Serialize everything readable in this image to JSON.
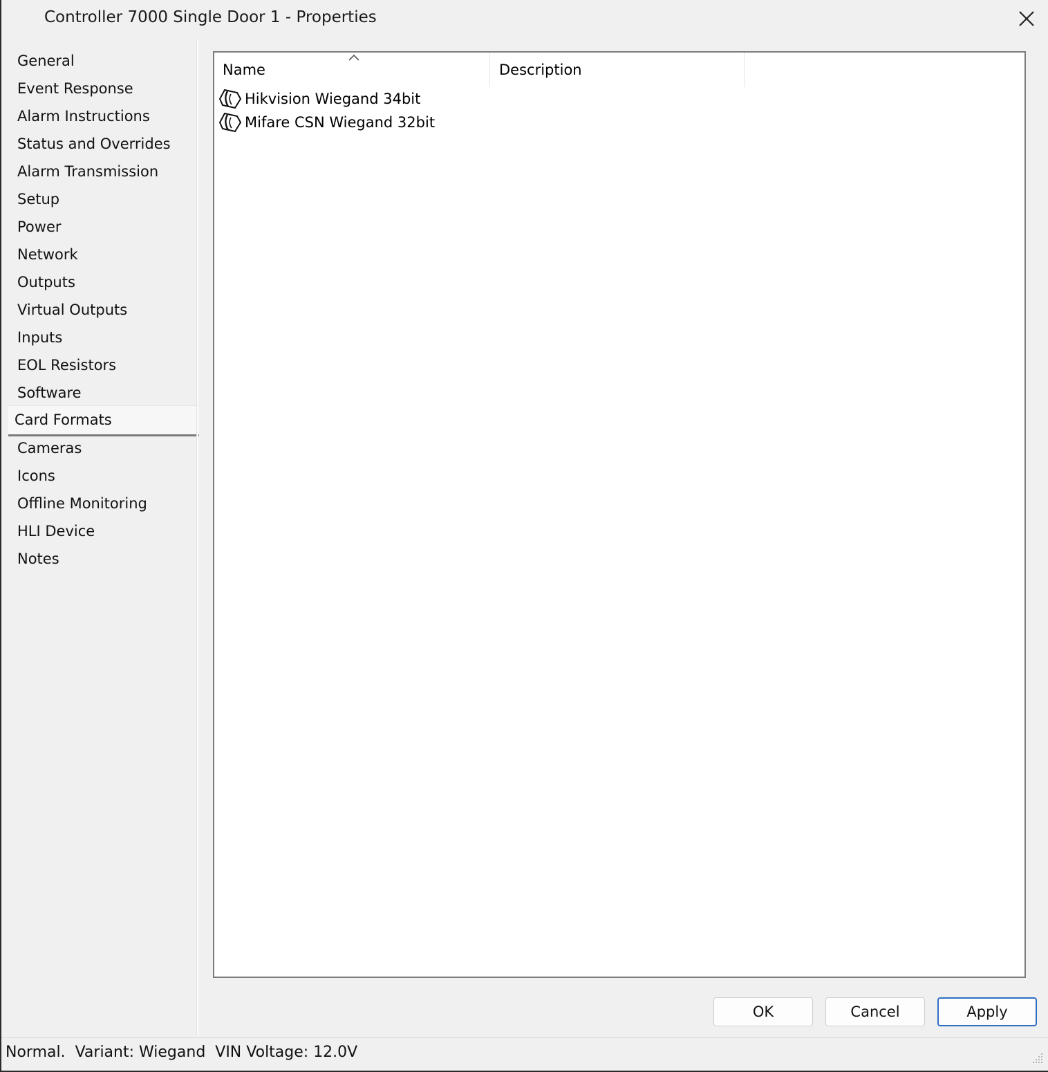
{
  "window": {
    "title": "Controller 7000 Single Door 1 - Properties"
  },
  "sidebar": {
    "items": [
      {
        "label": "General"
      },
      {
        "label": "Event Response"
      },
      {
        "label": "Alarm Instructions"
      },
      {
        "label": "Status and Overrides"
      },
      {
        "label": "Alarm Transmission"
      },
      {
        "label": "Setup"
      },
      {
        "label": "Power"
      },
      {
        "label": "Network"
      },
      {
        "label": "Outputs"
      },
      {
        "label": "Virtual Outputs"
      },
      {
        "label": "Inputs"
      },
      {
        "label": "EOL Resistors"
      },
      {
        "label": "Software"
      },
      {
        "label": "Card Formats",
        "selected": true
      },
      {
        "label": "Cameras"
      },
      {
        "label": "Icons"
      },
      {
        "label": "Offline Monitoring"
      },
      {
        "label": "HLI Device"
      },
      {
        "label": "Notes"
      }
    ]
  },
  "list": {
    "columns": [
      {
        "label": "Name"
      },
      {
        "label": "Description"
      }
    ],
    "sort_column": "Name",
    "rows": [
      {
        "name": "Hikvision Wiegand 34bit",
        "description": "",
        "icon": "card-format-icon"
      },
      {
        "name": "Mifare CSN Wiegand 32bit",
        "description": "",
        "icon": "card-format-icon"
      }
    ]
  },
  "buttons": {
    "ok": "OK",
    "cancel": "Cancel",
    "apply": "Apply"
  },
  "status": {
    "text": "Normal.  Variant: Wiegand  VIN Voltage: 12.0V"
  },
  "colors": {
    "default_button_border": "#2f6fc3",
    "selected_tab_underline": "#7a7a7a"
  }
}
